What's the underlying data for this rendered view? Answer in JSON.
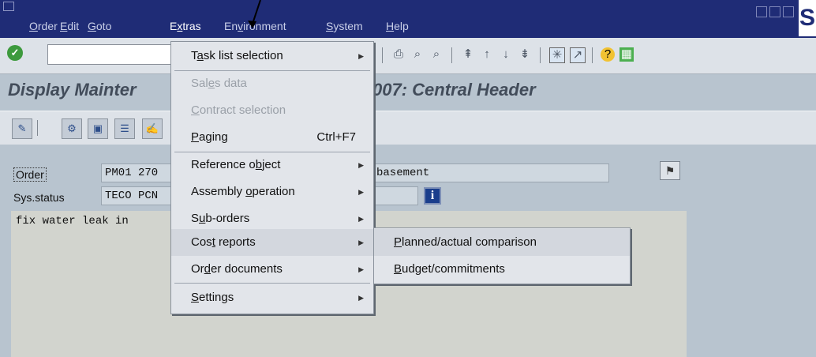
{
  "menubar": {
    "items": [
      {
        "pre": "",
        "key": "O",
        "post": "rder"
      },
      {
        "pre": "",
        "key": "E",
        "post": "dit"
      },
      {
        "pre": "",
        "key": "G",
        "post": "oto"
      },
      {
        "pre": "E",
        "key": "x",
        "post": "tras"
      },
      {
        "pre": "En",
        "key": "v",
        "post": "ironment"
      },
      {
        "pre": "",
        "key": "S",
        "post": "ystem"
      },
      {
        "pre": "",
        "key": "H",
        "post": "elp"
      }
    ],
    "logo": "S"
  },
  "title": "Display Mainter",
  "title_suffix": "007: Central Header",
  "fields": {
    "order_label": "Order",
    "order_value": "PM01 270",
    "order_desc": "basement",
    "sys_status_label": "Sys.status",
    "sys_status_value": "TECO PCN",
    "long_text": "fix water leak in",
    "info_icon_label": "i"
  },
  "extras_menu": {
    "items": [
      {
        "pre": "T",
        "key": "a",
        "post": "sk list selection",
        "submenu": true,
        "disabled": false
      },
      {
        "pre": "Sal",
        "key": "e",
        "post": "s data",
        "submenu": false,
        "disabled": true
      },
      {
        "pre": "",
        "key": "C",
        "post": "ontract selection",
        "submenu": false,
        "disabled": true
      },
      {
        "pre": "",
        "key": "P",
        "post": "aging",
        "shortcut": "Ctrl+F7",
        "submenu": false,
        "disabled": false
      },
      {
        "pre": "Reference o",
        "key": "b",
        "post": "ject",
        "submenu": true,
        "disabled": false
      },
      {
        "pre": "Assembly ",
        "key": "o",
        "post": "peration",
        "submenu": true,
        "disabled": false
      },
      {
        "pre": "S",
        "key": "u",
        "post": "b-orders",
        "submenu": true,
        "disabled": false
      },
      {
        "pre": "Cos",
        "key": "t",
        "post": " reports",
        "submenu": true,
        "disabled": false
      },
      {
        "pre": "Or",
        "key": "d",
        "post": "er documents",
        "submenu": true,
        "disabled": false
      },
      {
        "pre": "",
        "key": "S",
        "post": "ettings",
        "submenu": true,
        "disabled": false
      }
    ]
  },
  "cost_reports_menu": {
    "items": [
      {
        "pre": "",
        "key": "P",
        "post": "lanned/actual comparison"
      },
      {
        "pre": "",
        "key": "B",
        "post": "udget/commitments"
      }
    ]
  },
  "icons": {
    "check": "check-icon",
    "flag": "header-flag-icon",
    "info": "info-icon"
  }
}
